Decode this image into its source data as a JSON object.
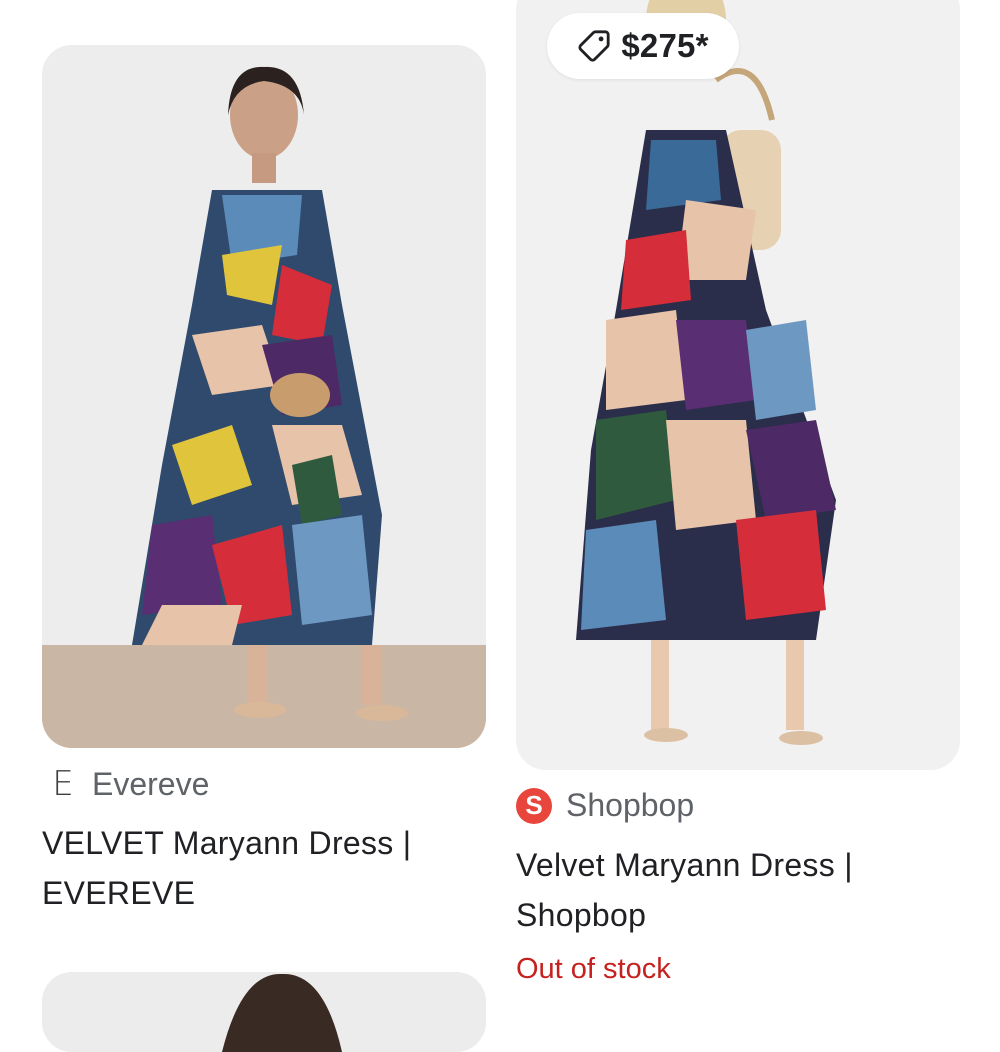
{
  "results": [
    {
      "source": {
        "name": "Evereve",
        "favicon_letter": "E"
      },
      "title": "VELVET Maryann Dress | EVEREVE"
    },
    {
      "price": "$275*",
      "source": {
        "name": "Shopbop",
        "favicon_letter": "S"
      },
      "title": "Velvet Maryann Dress | Shopbop",
      "stock_status": "Out of stock"
    }
  ],
  "icons": {
    "price_tag": "tag-icon"
  },
  "colors": {
    "out_of_stock": "#c5221f",
    "shopbop_brand": "#e8453c"
  }
}
